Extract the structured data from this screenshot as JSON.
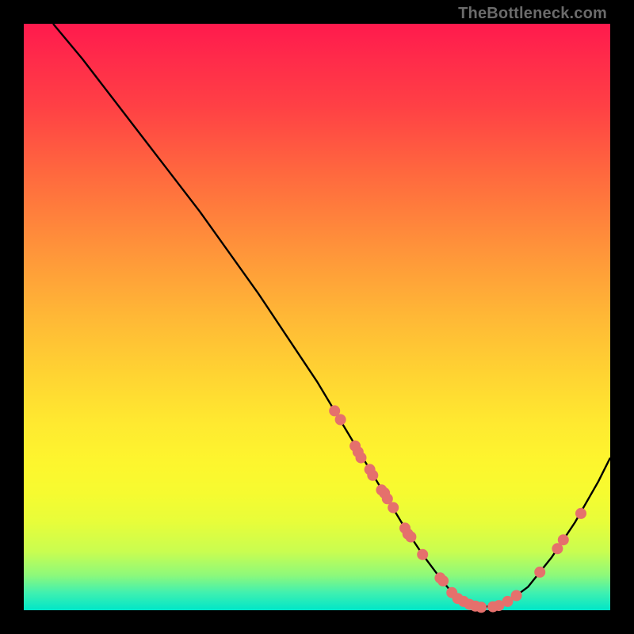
{
  "watermark": "TheBottleneck.com",
  "colors": {
    "page_bg": "#000000",
    "curve_stroke": "#000000",
    "marker_fill": "#e5706c",
    "watermark_text": "#6b6b6b"
  },
  "chart_data": {
    "type": "line",
    "title": "",
    "xlabel": "",
    "ylabel": "",
    "xlim": [
      0,
      100
    ],
    "ylim": [
      0,
      100
    ],
    "grid": false,
    "legend": false,
    "series": [
      {
        "name": "bottleneck-curve",
        "x": [
          5,
          10,
          15,
          20,
          25,
          30,
          35,
          40,
          45,
          50,
          53,
          56,
          59,
          62,
          65,
          68,
          71,
          73,
          75,
          78,
          82,
          86,
          90,
          94,
          98,
          100
        ],
        "y": [
          100,
          94,
          87.5,
          81,
          74.5,
          68,
          61,
          54,
          46.5,
          39,
          34,
          29,
          24,
          19,
          14,
          9.5,
          5.5,
          3,
          1.5,
          0.5,
          1,
          4,
          9,
          15,
          22,
          26
        ]
      }
    ],
    "markers": [
      {
        "x": 53,
        "y": 34
      },
      {
        "x": 54,
        "y": 32.5
      },
      {
        "x": 56.5,
        "y": 28
      },
      {
        "x": 57,
        "y": 27
      },
      {
        "x": 57.5,
        "y": 26
      },
      {
        "x": 59,
        "y": 24
      },
      {
        "x": 59.5,
        "y": 23
      },
      {
        "x": 61,
        "y": 20.5
      },
      {
        "x": 61.5,
        "y": 20
      },
      {
        "x": 62,
        "y": 19
      },
      {
        "x": 63,
        "y": 17.5
      },
      {
        "x": 65,
        "y": 14
      },
      {
        "x": 65.5,
        "y": 13
      },
      {
        "x": 66,
        "y": 12.5
      },
      {
        "x": 68,
        "y": 9.5
      },
      {
        "x": 71,
        "y": 5.5
      },
      {
        "x": 71.5,
        "y": 5
      },
      {
        "x": 73,
        "y": 3
      },
      {
        "x": 74,
        "y": 2
      },
      {
        "x": 75,
        "y": 1.5
      },
      {
        "x": 76,
        "y": 1
      },
      {
        "x": 77,
        "y": 0.7
      },
      {
        "x": 78,
        "y": 0.5
      },
      {
        "x": 80,
        "y": 0.6
      },
      {
        "x": 81,
        "y": 0.8
      },
      {
        "x": 82.5,
        "y": 1.5
      },
      {
        "x": 84,
        "y": 2.5
      },
      {
        "x": 88,
        "y": 6.5
      },
      {
        "x": 91,
        "y": 10.5
      },
      {
        "x": 92,
        "y": 12
      },
      {
        "x": 95,
        "y": 16.5
      }
    ]
  }
}
